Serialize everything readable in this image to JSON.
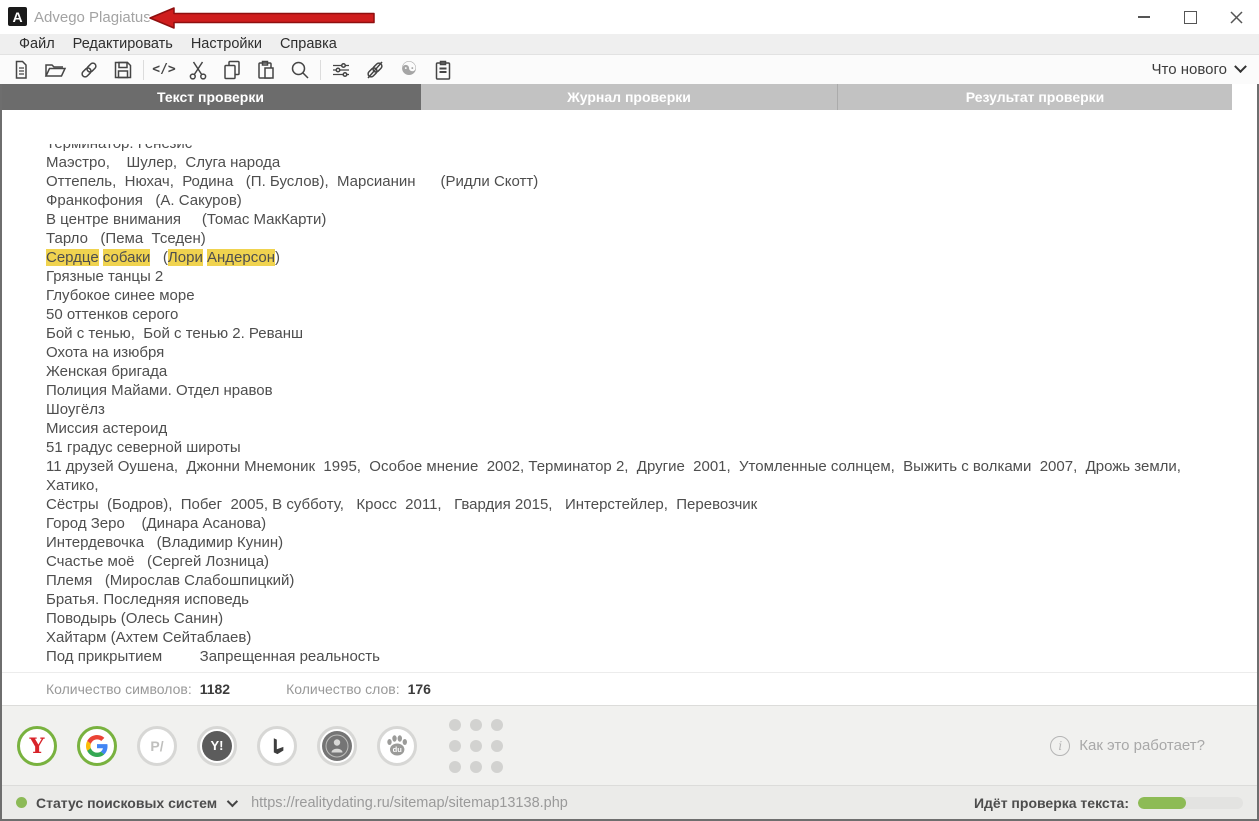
{
  "window": {
    "logo_letter": "A",
    "title": "Advego Plagiatus 3.0.13"
  },
  "menu": {
    "items": [
      "Файл",
      "Редактировать",
      "Настройки",
      "Справка"
    ]
  },
  "toolbar": {
    "whats_new": "Что нового",
    "code_glyph": "</>",
    "yinyang_glyph": "☯"
  },
  "tabs": {
    "items": [
      {
        "label": "Текст проверки",
        "active": true
      },
      {
        "label": "Журнал проверки",
        "active": false
      },
      {
        "label": "Результат проверки",
        "active": false
      }
    ]
  },
  "text": {
    "lines": [
      {
        "text": "Терминатор: Генезис"
      },
      {
        "text": "Маэстро,    Шулер,  Слуга народа"
      },
      {
        "text": "Оттепель,  Нюхач,  Родина   (П. Буслов),  Марсианин      (Ридли Скотт)"
      },
      {
        "text": "Франкофония   (А. Сакуров)"
      },
      {
        "text": "В центре внимания     (Томас МакКарти)"
      },
      {
        "text": "Тарло   (Пема  Тседен)"
      },
      {
        "segments": [
          {
            "t": "Сердце",
            "hl": true
          },
          {
            "t": " "
          },
          {
            "t": "собаки",
            "hl": true
          },
          {
            "t": "   ("
          },
          {
            "t": "Лори",
            "hl": true
          },
          {
            "t": " "
          },
          {
            "t": "Андерсон",
            "hl": true
          },
          {
            "t": ")"
          }
        ]
      },
      {
        "text": "Грязные танцы 2"
      },
      {
        "text": "Глубокое синее море"
      },
      {
        "text": "50 оттенков серого"
      },
      {
        "text": "Бой с тенью,  Бой с тенью 2. Реванш"
      },
      {
        "text": "Охота на изюбря"
      },
      {
        "text": "Женская бригада"
      },
      {
        "text": "Полиция Майами. Отдел нравов"
      },
      {
        "text": "Шоугёлз"
      },
      {
        "text": "Миссия астероид"
      },
      {
        "text": "51 градус северной широты"
      },
      {
        "text": "11 друзей Оушена,  Джонни Мнемоник  1995,  Особое мнение  2002, Терминатор 2,  Другие  2001,  Утомленные солнцем,  Выжить с волками  2007,  Дрожь земли, Хатико,"
      },
      {
        "text": "Сёстры  (Бодров),  Побег  2005, В субботу,   Кросс  2011,   Гвардия 2015,   Интерстейлер,  Перевозчик"
      },
      {
        "text": "Город Зеро    (Динара Асанова)"
      },
      {
        "text": "Интердевочка   (Владимир Кунин)"
      },
      {
        "text": "Счастье моё   (Сергей Лозница)"
      },
      {
        "text": "Племя   (Мирослав Слабошпицкий)"
      },
      {
        "text": "Братья. Последняя исповедь"
      },
      {
        "text": "Поводырь (Олесь Санин)"
      },
      {
        "text": "Хайтарм (Ахтем Сейтаблаев)"
      },
      {
        "text": "Под прикрытием         Запрещенная реальность"
      }
    ]
  },
  "counters": {
    "chars_label": "Количество символов:",
    "chars_value": "1182",
    "words_label": "Количество слов:",
    "words_value": "176"
  },
  "engines": {
    "items": [
      {
        "name": "yandex",
        "glyph": "Y",
        "active": true
      },
      {
        "name": "google",
        "active": true
      },
      {
        "name": "engine-p",
        "glyph": "P/",
        "active": false
      },
      {
        "name": "yahoo",
        "glyph": "Y!",
        "active": false
      },
      {
        "name": "bing",
        "active": false
      },
      {
        "name": "profile-coin",
        "active": false
      },
      {
        "name": "baidu",
        "glyph": "du",
        "active": false
      },
      {
        "name": "more-engines",
        "active": false
      }
    ],
    "help_label": "Как это работает?"
  },
  "statusbar": {
    "status_label": "Статус поисковых систем",
    "url": "https://realitydating.ru/sitemap/sitemap13138.php",
    "progress_label": "Идёт проверка текста:",
    "progress_percent": 46
  },
  "colors": {
    "highlight": "#f0d34f",
    "accent_green": "#79b23f",
    "progress_fill": "#8dbb55",
    "arrow_red": "#c9201d"
  }
}
